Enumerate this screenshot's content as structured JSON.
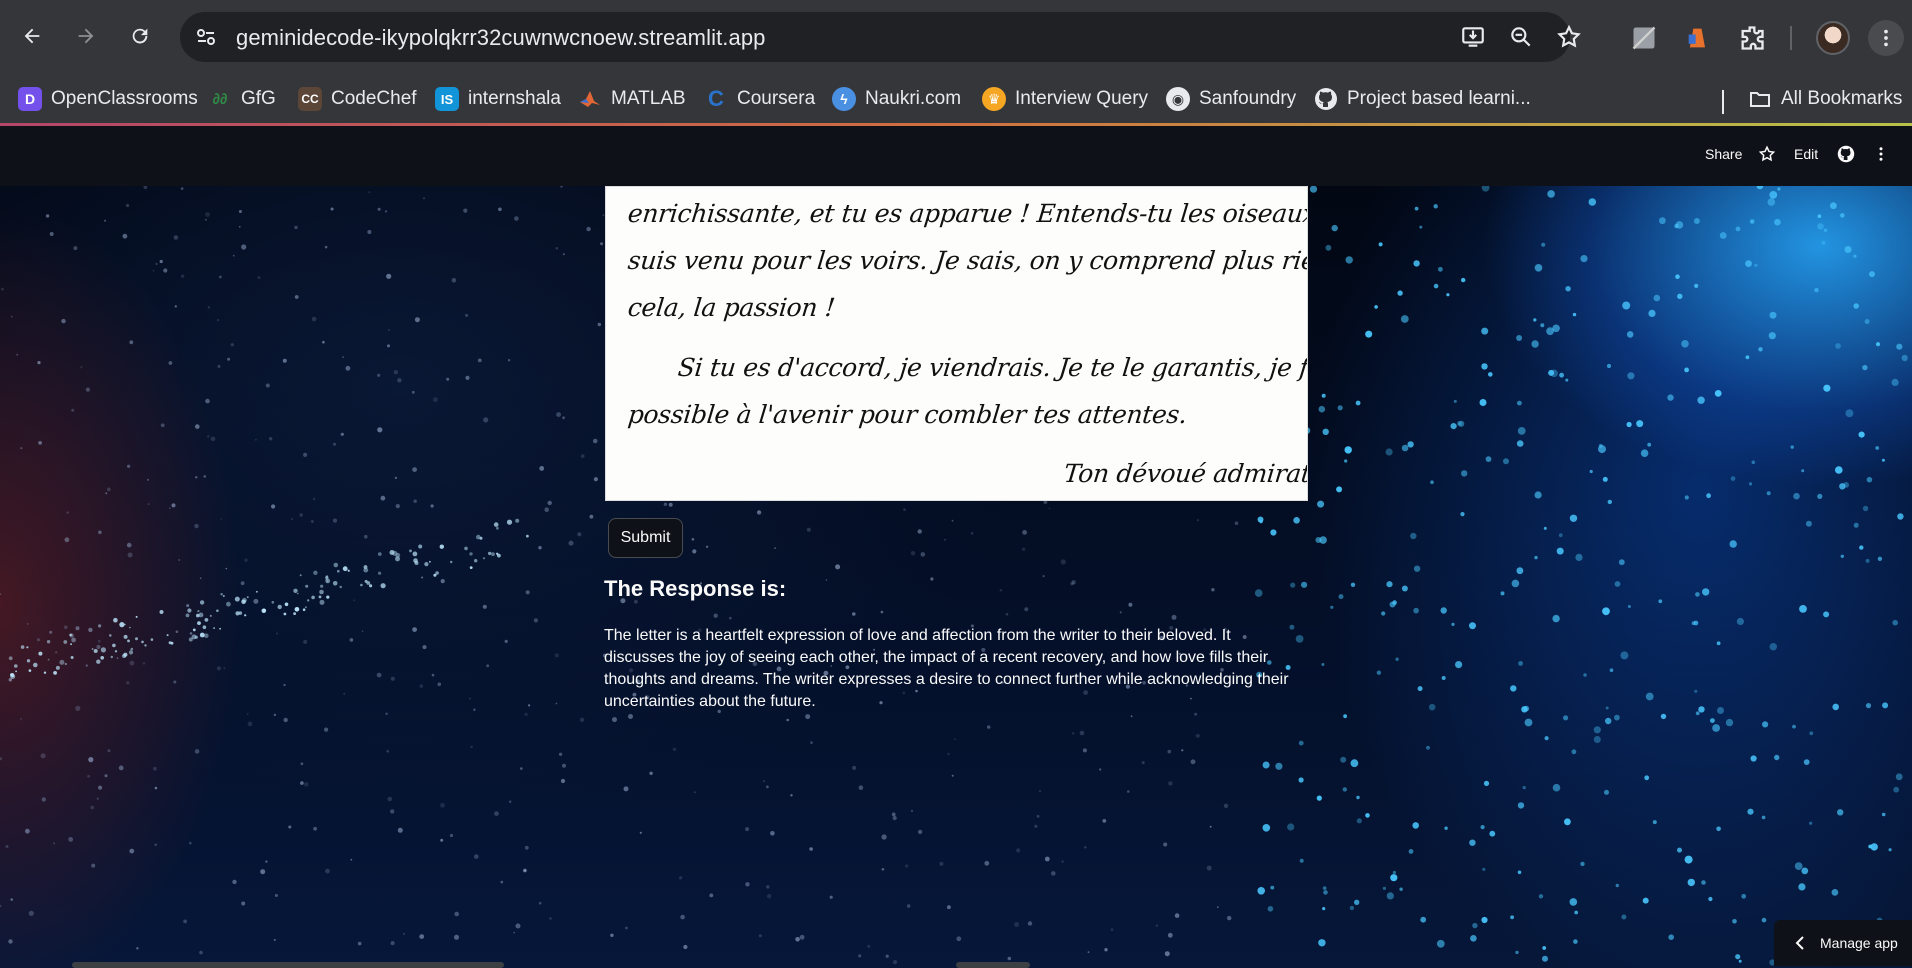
{
  "browser": {
    "url": "geminidecode-ikypolqkrr32cuwnwcnoew.streamlit.app",
    "bookmarks": [
      {
        "label": "OpenClassrooms",
        "icon": "openclassrooms-icon",
        "color": "#7451eb"
      },
      {
        "label": "GfG",
        "icon": "gfg-icon",
        "color": "#2f8d46"
      },
      {
        "label": "CodeChef",
        "icon": "codechef-icon",
        "color": "#5b4638"
      },
      {
        "label": "internshala",
        "icon": "internshala-icon",
        "color": "#1295d8"
      },
      {
        "label": "MATLAB",
        "icon": "matlab-icon",
        "color": "#e16737"
      },
      {
        "label": "Coursera",
        "icon": "coursera-icon",
        "color": "#2a73cc"
      },
      {
        "label": "Naukri.com",
        "icon": "naukri-icon",
        "color": "#4a90e2"
      },
      {
        "label": "Interview Query",
        "icon": "interview-query-icon",
        "color": "#f5a623"
      },
      {
        "label": "Sanfoundry",
        "icon": "sanfoundry-icon",
        "color": "#e8eaed"
      },
      {
        "label": "Project based learni...",
        "icon": "github-icon",
        "color": "#e8eaed"
      }
    ],
    "all_bookmarks_label": "All Bookmarks"
  },
  "app_header": {
    "share_label": "Share",
    "edit_label": "Edit"
  },
  "letter": {
    "lines": [
      "enrichissante, et tu es apparue ! Entends-tu les oiseaux du bonheur ? Je",
      "suis venu pour les voirs.  Je sais, on y comprend plus rien, mais c'est",
      "cela, la passion !",
      "Si tu es d'accord, je viendrais. Je te le garantis, je ferais mon",
      "possible à l'avenir pour combler tes attentes.",
      "Ton dévoué admirateur..."
    ]
  },
  "form": {
    "submit_label": "Submit"
  },
  "response": {
    "title": "The Response is:",
    "text": "The letter is a heartfelt expression of love and affection from the writer to their beloved. It discusses the joy of seeing each other, the impact of a recent recovery, and how love fills their thoughts and dreams. The writer expresses a desire to connect further while acknowledging their uncertainties about the future."
  },
  "footer": {
    "manage_app_label": "Manage app"
  },
  "colors": {
    "chrome_bg": "#35363a",
    "streamlit_bg": "#0e1117",
    "text_primary": "#fafafa"
  }
}
